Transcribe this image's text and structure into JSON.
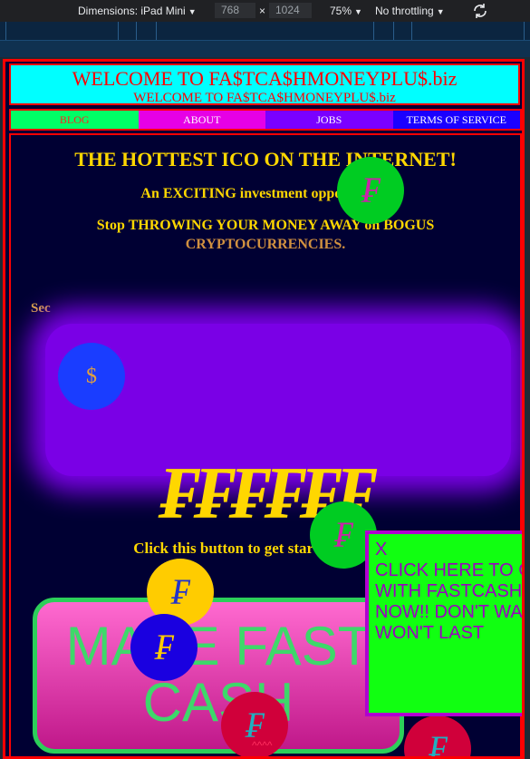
{
  "devtools": {
    "dimensions_label": "Dimensions: iPad Mini",
    "width": "768",
    "times": "×",
    "height": "1024",
    "zoom": "75%",
    "throttling": "No throttling",
    "rotate_icon": "rotate-icon"
  },
  "site": {
    "title": "WELCOME TO FA$TCA$HMONEYPLU$.biz",
    "subtitle": "WELCOME TO FA$TCA$HMONEYPLU$.biz",
    "nav": [
      {
        "label": "BLOG",
        "color": "#00ff66"
      },
      {
        "label": "ABOUT",
        "color": "#e600e6"
      },
      {
        "label": "JOBS",
        "color": "#7a00ff"
      },
      {
        "label": "TERMS OF SERVICE",
        "color": "#1a00ff"
      }
    ],
    "headline": "THE HOTTEST ICO ON THE INTERNET!",
    "line1": "An EXCITING investment opportunity!",
    "line2": "Stop THROWING YOUR MONEY AWAY on BOGUS",
    "line2b": "CRYPTOCURRENCIES.",
    "partial_left": "Sec",
    "symbols": "₣₣₣₣₣₣",
    "click_text": "Click this button to get started NOW =>",
    "cta_label": "MAKE FAST CASH",
    "popup": {
      "close": "X",
      "text": "CLICK HERE TO GET STARTED WITH FASTCASHMONEY NOW!! DON'T WAIT THIS WON'T LAST"
    },
    "coins": [
      {
        "glyph": "₣",
        "bg": "#00cc22",
        "fg": "#cc22aa"
      },
      {
        "glyph": "$",
        "bg": "#1a3dff",
        "fg": "#e0a040"
      },
      {
        "glyph": "₣",
        "bg": "#00cc22",
        "fg": "#cc22aa"
      },
      {
        "glyph": "₣",
        "bg": "#ffcc00",
        "fg": "#2233cc"
      },
      {
        "glyph": "₣",
        "bg": "#1a00e0",
        "fg": "#ffcc00"
      },
      {
        "glyph": "₣",
        "bg": "#d0003a",
        "fg": "#20b0c0"
      },
      {
        "glyph": "₣",
        "bg": "#d0003a",
        "fg": "#20b0c0"
      }
    ],
    "carets": "^^^^"
  }
}
